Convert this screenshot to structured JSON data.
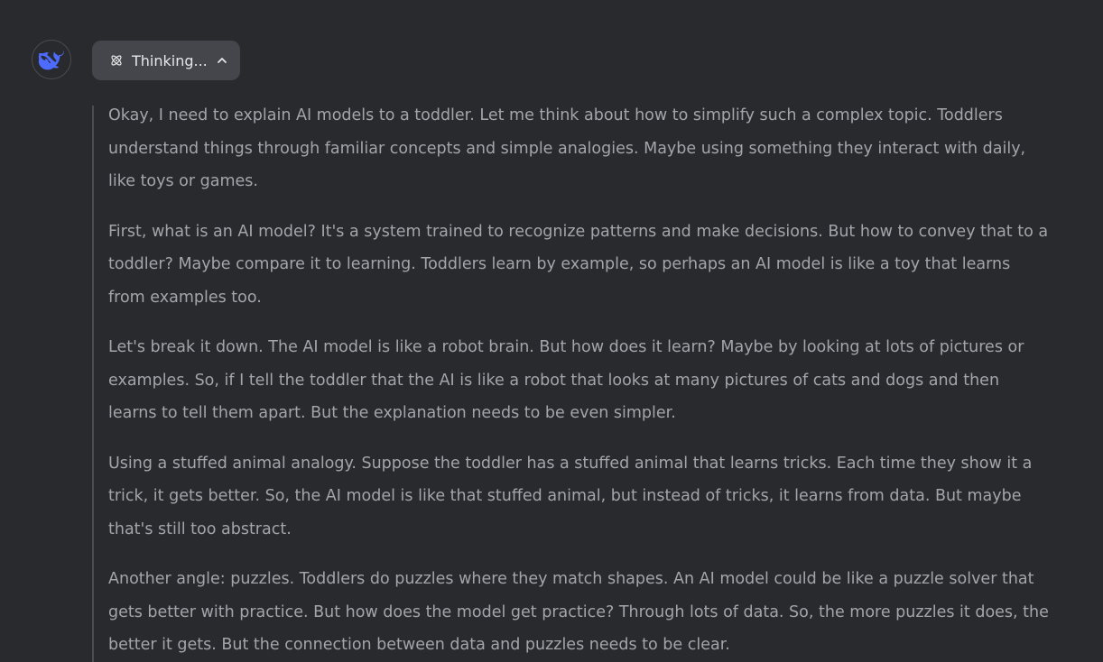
{
  "header": {
    "avatar_icon": "deepseek-whale-icon",
    "thinking_label": "Thinking...",
    "thinking_icon": "atom-icon",
    "toggle_icon": "chevron-up-icon"
  },
  "colors": {
    "background": "#292a2d",
    "toggle_bg": "#44464c",
    "thought_text": "#a3a5aa",
    "brand_blue": "#4d6bfe"
  },
  "thought": {
    "paragraphs": [
      "Okay, I need to explain AI models to a toddler. Let me think about how to simplify such a complex topic. Toddlers understand things through familiar concepts and simple analogies. Maybe using something they interact with daily, like toys or games.",
      "First, what is an AI model? It's a system trained to recognize patterns and make decisions. But how to convey that to a toddler? Maybe compare it to learning. Toddlers learn by example, so perhaps an AI model is like a toy that learns from examples too.",
      "Let's break it down. The AI model is like a robot brain. But how does it learn? Maybe by looking at lots of pictures or examples. So, if I tell the toddler that the AI is like a robot that looks at many pictures of cats and dogs and then learns to tell them apart. But the explanation needs to be even simpler.",
      "Using a stuffed animal analogy. Suppose the toddler has a stuffed animal that learns tricks. Each time they show it a trick, it gets better. So, the AI model is like that stuffed animal, but instead of tricks, it learns from data. But maybe that's still too abstract.",
      "Another angle: puzzles. Toddlers do puzzles where they match shapes. An AI model could be like a puzzle solver that gets better with practice. But how does the model get practice? Through lots of data. So, the more puzzles it does, the better it gets. But the connection between data and puzzles needs to be clear."
    ]
  }
}
